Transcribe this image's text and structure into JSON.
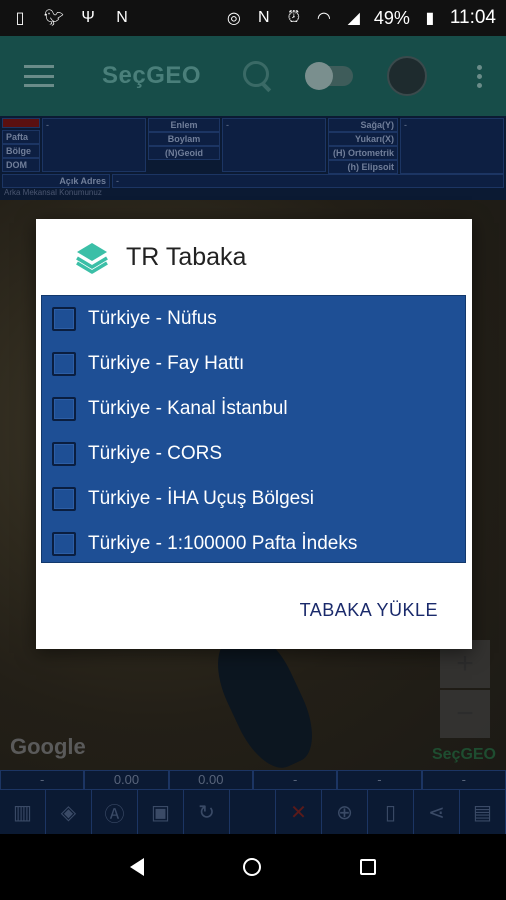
{
  "status_bar": {
    "icons_left": [
      "sim-icon",
      "twitter-icon",
      "usb-icon",
      "n-app-icon"
    ],
    "icons_right": [
      "location-icon",
      "nfc-icon",
      "alarm-icon",
      "wifi-icon",
      "signal-icon"
    ],
    "battery": "49%",
    "time": "11:04"
  },
  "app_bar": {
    "title": "SeçGEO"
  },
  "info_table": {
    "col1_labels": [
      "Pafta",
      "Bölge",
      "DOM"
    ],
    "col2_labels": [
      "Enlem",
      "Boylam",
      "(N)Geoid"
    ],
    "col3_labels": [
      "Sağa(Y)",
      "Yukarı(X)",
      "(H) Ortometrik",
      "(h) Elipsoit"
    ],
    "value_placeholder": "-",
    "address_label": "Açık Adres",
    "address_value": "-",
    "subtext": "Arka Mekansal Konumunuz"
  },
  "map": {
    "google_label": "Google",
    "brand_label": "SeçGEO",
    "zoom_in": "+",
    "zoom_out": "−"
  },
  "coords": [
    "-",
    "0.00",
    "0.00",
    "-",
    "-",
    "-"
  ],
  "dialog": {
    "title": "TR Tabaka",
    "items": [
      {
        "label": "Türkiye - Nüfus",
        "checked": false
      },
      {
        "label": "Türkiye - Fay Hattı",
        "checked": false
      },
      {
        "label": "Türkiye - Kanal İstanbul",
        "checked": false
      },
      {
        "label": "Türkiye - CORS",
        "checked": false
      },
      {
        "label": "Türkiye - İHA Uçuş Bölgesi",
        "checked": false
      },
      {
        "label": "Türkiye - 1:100000 Pafta İndeks",
        "checked": false
      }
    ],
    "action_label": "TABAKA YÜKLE"
  },
  "colors": {
    "list_bg": "#1e4f95",
    "action_text": "#1a2a6b",
    "layers_icon": "#3bbfa7"
  }
}
